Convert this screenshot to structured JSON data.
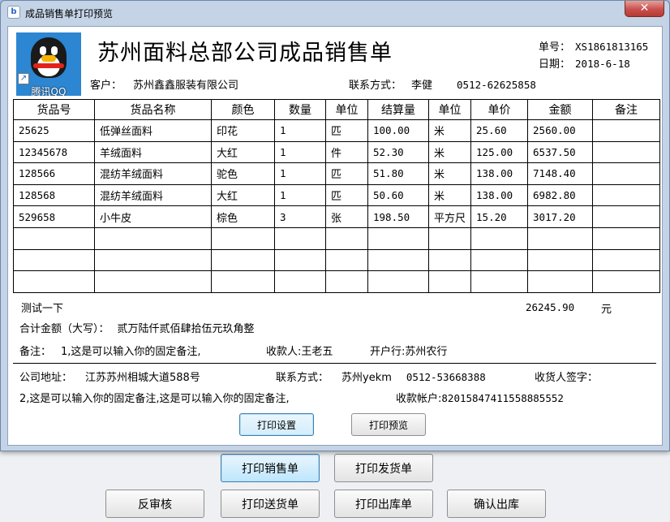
{
  "window": {
    "title": "成品销售单打印预览",
    "close_glyph": "✕"
  },
  "logo": {
    "label": "腾讯QQ"
  },
  "document": {
    "title": "苏州面料总部公司成品销售单",
    "order_no_label": "单号：",
    "order_no": "XS1861813165",
    "date_label": "日期：",
    "date": "2018-6-18",
    "customer_label": "客户：",
    "customer": "苏州鑫鑫服装有限公司",
    "contact_label": "联系方式：",
    "contact_name": "李健",
    "contact_phone": "0512-62625858"
  },
  "table": {
    "headers": [
      "货品号",
      "货品名称",
      "颜色",
      "数量",
      "单位",
      "结算量",
      "单位",
      "单价",
      "金额",
      "备注"
    ],
    "rows": [
      [
        "25625",
        "低弹丝面料",
        "印花",
        "1",
        "匹",
        "100.00",
        "米",
        "25.60",
        "2560.00",
        ""
      ],
      [
        "12345678",
        "羊绒面料",
        "大红",
        "1",
        "件",
        "52.30",
        "米",
        "125.00",
        "6537.50",
        ""
      ],
      [
        "128566",
        "混纺羊绒面料",
        "驼色",
        "1",
        "匹",
        "51.80",
        "米",
        "138.00",
        "7148.40",
        ""
      ],
      [
        "128568",
        "混纺羊绒面料",
        "大红",
        "1",
        "匹",
        "50.60",
        "米",
        "138.00",
        "6982.80",
        ""
      ],
      [
        "529658",
        "小牛皮",
        "棕色",
        "3",
        "张",
        "198.50",
        "平方尺",
        "15.20",
        "3017.20",
        ""
      ],
      [
        "",
        "",
        "",
        "",
        "",
        "",
        "",
        "",
        "",
        ""
      ],
      [
        "",
        "",
        "",
        "",
        "",
        "",
        "",
        "",
        "",
        ""
      ],
      [
        "",
        "",
        "",
        "",
        "",
        "",
        "",
        "",
        "",
        ""
      ]
    ]
  },
  "summary": {
    "test_text": "测试一下",
    "total": "26245.90",
    "currency": "元",
    "total_words_label": "合计金额（大写）：",
    "total_words": "贰万陆仟贰佰肆拾伍元玖角整",
    "remark_label": "备注：",
    "remark": "1,这是可以输入你的固定备注,",
    "payee_label": "收款人:",
    "payee": "王老五",
    "bank_label": "开户行:",
    "bank": "苏州农行"
  },
  "footer": {
    "address_label": "公司地址：",
    "address": "江苏苏州相城大道588号",
    "contact_label": "联系方式：",
    "contact": "苏州yekm",
    "phone": "0512-53668388",
    "receiver_label": "收货人签字：",
    "remark2": "2,这是可以输入你的固定备注,这是可以输入你的固定备注,",
    "account_label": "收款帐户:",
    "account": "82015847411558885552"
  },
  "dialog_buttons": {
    "setup": "打印设置",
    "preview": "打印预览"
  },
  "main_buttons": {
    "print_sales": "打印销售单",
    "print_shipping": "打印发货单",
    "unapprove": "反审核",
    "print_delivery": "打印送货单",
    "print_outbound": "打印出库单",
    "confirm_outbound": "确认出库"
  }
}
